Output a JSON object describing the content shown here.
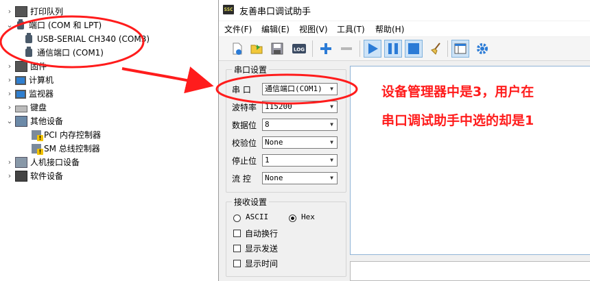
{
  "device_tree": {
    "rows": [
      {
        "label": "打印队列",
        "icon": "printer-icon",
        "expander": "›"
      },
      {
        "label": "端口 (COM 和 LPT)",
        "icon": "port-icon",
        "expander": "⌄"
      },
      {
        "label": "USB-SERIAL CH340 (COM3)",
        "icon": "port-icon",
        "expander": ""
      },
      {
        "label": "通信端口 (COM1)",
        "icon": "port-icon",
        "expander": ""
      },
      {
        "label": "固件",
        "icon": "chip-icon",
        "expander": "›"
      },
      {
        "label": "计算机",
        "icon": "monitor-icon",
        "expander": "›"
      },
      {
        "label": "监视器",
        "icon": "monitor-icon",
        "expander": "›"
      },
      {
        "label": "键盘",
        "icon": "keyboard-icon",
        "expander": "›"
      },
      {
        "label": "其他设备",
        "icon": "other-device-icon",
        "expander": "⌄"
      },
      {
        "label": "PCI 内存控制器",
        "icon": "warning-device-icon",
        "expander": ""
      },
      {
        "label": "SM 总线控制器",
        "icon": "warning-device-icon",
        "expander": ""
      },
      {
        "label": "人机接口设备",
        "icon": "hid-icon",
        "expander": "›"
      },
      {
        "label": "软件设备",
        "icon": "software-device-icon",
        "expander": "›"
      }
    ]
  },
  "annotation": {
    "line1": "设备管理器中是3，用户在",
    "line2": "串口调试助手中选的却是1",
    "color": "#ff1c1c"
  },
  "window": {
    "logo_text": "SSC",
    "title": "友善串口调试助手",
    "menus": [
      "文件(F)",
      "编辑(E)",
      "视图(V)",
      "工具(T)",
      "帮助(H)"
    ],
    "toolbar_icons": [
      "new-icon",
      "open-icon",
      "save-icon",
      "log-icon",
      "plus-icon",
      "minus-icon",
      "play-icon",
      "pause-icon",
      "stop-icon",
      "clear-broom-icon",
      "layout-icon",
      "settings-gear-icon"
    ],
    "log_label": "LOG",
    "serial_settings": {
      "title": "串口设置",
      "port_label": "串  口",
      "port_value": "通信端口(COM1)",
      "baud_label": "波特率",
      "baud_value": "115200",
      "data_bits_label": "数据位",
      "data_bits_value": "8",
      "parity_label": "校验位",
      "parity_value": "None",
      "stop_bits_label": "停止位",
      "stop_bits_value": "1",
      "flow_label": "流  控",
      "flow_value": "None"
    },
    "receive_settings": {
      "title": "接收设置",
      "ascii_label": "ASCII",
      "hex_label": "Hex",
      "selected": "Hex",
      "auto_newline_label": "自动换行",
      "show_send_label": "显示发送",
      "show_time_label": "显示时间"
    }
  },
  "colors": {
    "accent_blue": "#2b7bd6",
    "annotation_red": "#ff1c1c"
  }
}
